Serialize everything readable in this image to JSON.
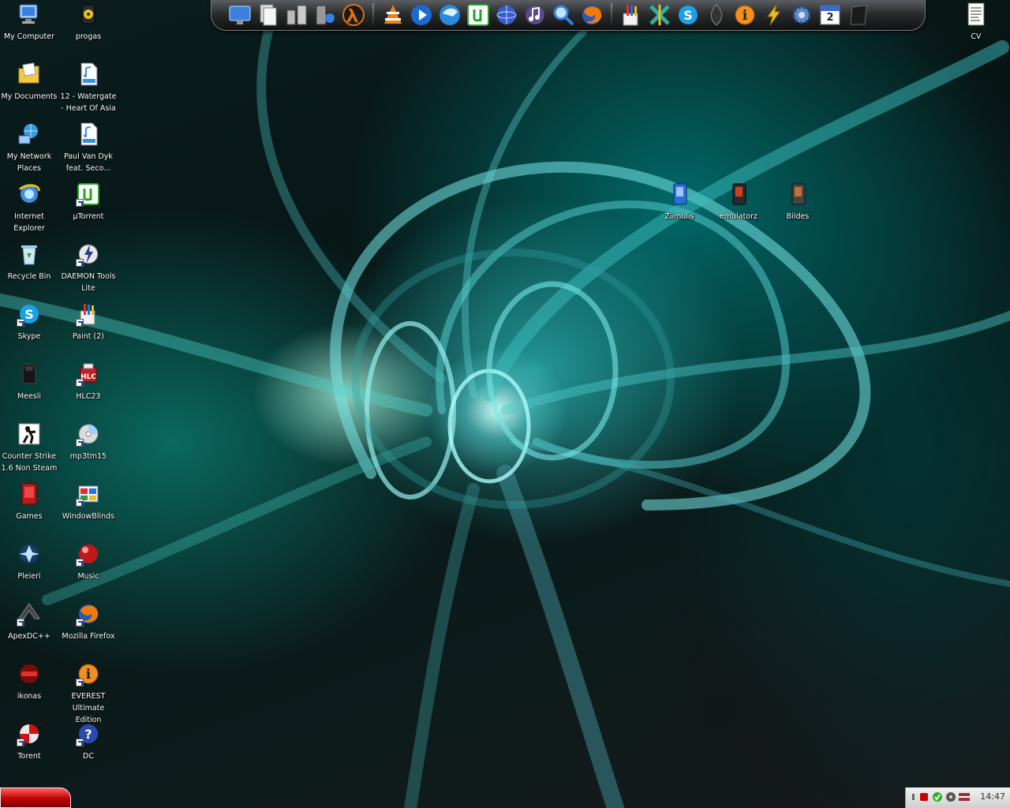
{
  "desktop": {
    "left_icons": [
      {
        "label": "My Computer",
        "icon": "computer-icon"
      },
      {
        "label": "progas",
        "icon": "biohazard-bin-icon"
      },
      {
        "label": "My Documents",
        "icon": "folder-documents-icon"
      },
      {
        "label": "12 - Watergate\n- Heart Of Asia",
        "icon": "mp3-file-icon"
      },
      {
        "label": "My Network\nPlaces",
        "icon": "network-icon"
      },
      {
        "label": "Paul Van Dyk\nfeat. Seco...",
        "icon": "mp3-file-icon"
      },
      {
        "label": "Internet\nExplorer",
        "icon": "internet-explorer-icon"
      },
      {
        "label": "µTorrent",
        "icon": "utorrent-icon"
      },
      {
        "label": "Recycle Bin",
        "icon": "recycle-bin-icon"
      },
      {
        "label": "DAEMON Tools\nLite",
        "icon": "daemon-tools-icon"
      },
      {
        "label": "Skype",
        "icon": "skype-icon"
      },
      {
        "label": "Paint (2)",
        "icon": "paint-icon"
      },
      {
        "label": "Meesli",
        "icon": "black-box-icon"
      },
      {
        "label": "HLC23",
        "icon": "hlc-icon"
      },
      {
        "label": "Counter Strike\n1.6 Non Steam",
        "icon": "counter-strike-icon"
      },
      {
        "label": "mp3tm15",
        "icon": "cd-icon"
      },
      {
        "label": "Games",
        "icon": "games-folder-icon"
      },
      {
        "label": "WindowBlinds",
        "icon": "windowblinds-icon"
      },
      {
        "label": "Pleieri",
        "icon": "player-icon"
      },
      {
        "label": "Music",
        "icon": "music-ball-icon"
      },
      {
        "label": "ApexDC++",
        "icon": "apexdc-icon"
      },
      {
        "label": "Mozilla Firefox",
        "icon": "firefox-icon"
      },
      {
        "label": "ikonas",
        "icon": "ikonas-icon"
      },
      {
        "label": "EVEREST\nUltimate Edition",
        "icon": "everest-icon"
      },
      {
        "label": "Torent",
        "icon": "torent-icon"
      },
      {
        "label": "DC",
        "icon": "dc-icon"
      }
    ],
    "right_icons": [
      {
        "label": "CV",
        "icon": "document-icon"
      },
      {
        "label": "Ziimulis",
        "icon": "folder-blue-icon"
      },
      {
        "label": "emulatorz",
        "icon": "folder-red-icon"
      },
      {
        "label": "Bildes",
        "icon": "folder-grey-icon"
      }
    ]
  },
  "dock": {
    "items": [
      "monitor-icon",
      "documents-icon",
      "tools-icon",
      "network-share-icon",
      "half-life-icon",
      "vlc-icon",
      "media-player-icon",
      "quicktime-icon",
      "utorrent-icon",
      "globe-icon",
      "music-note-icon",
      "search-icon",
      "firefox-icon",
      "paint-icon",
      "tool-x-icon",
      "skype-icon",
      "apex-icon",
      "info-icon",
      "lightning-icon",
      "settings-icon",
      "calendar-icon",
      "black-box-icon"
    ],
    "calendar_day": "2"
  },
  "taskbar": {
    "clock": "14:47"
  },
  "colors": {
    "accent": "#0a8f8f",
    "start_button": "#c00000"
  }
}
